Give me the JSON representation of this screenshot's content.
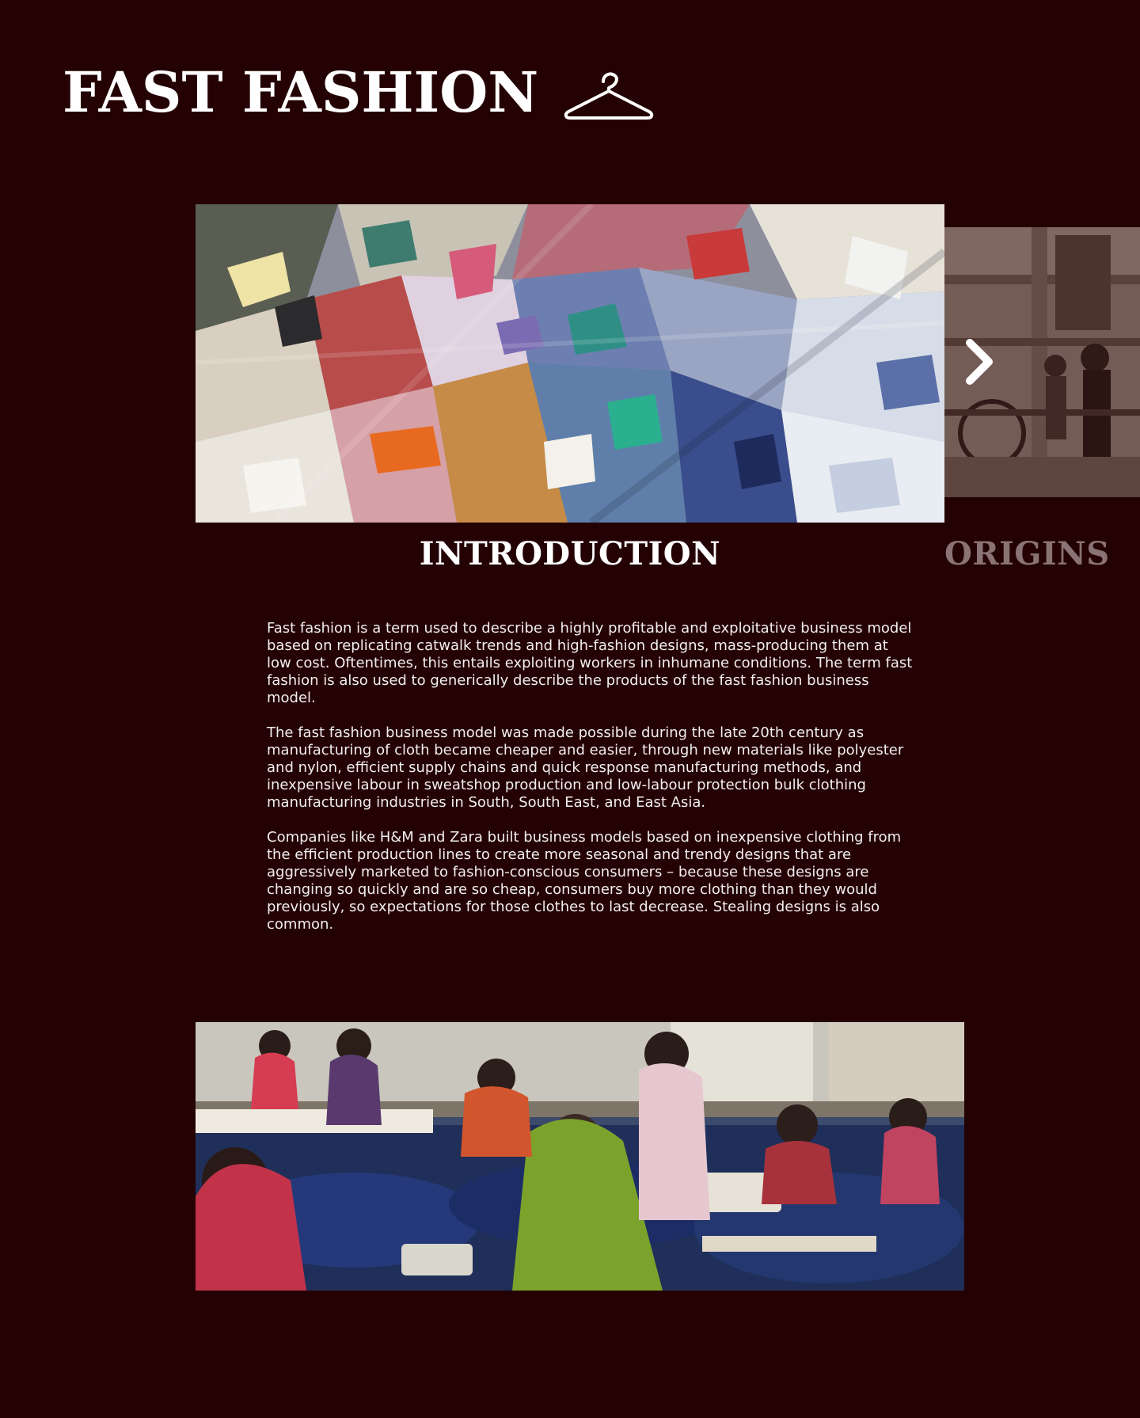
{
  "header": {
    "title": "FAST FASHION",
    "icon": "hanger-icon"
  },
  "carousel": {
    "current": {
      "caption": "INTRODUCTION",
      "image_subject": "pile of discarded textiles"
    },
    "next": {
      "caption": "ORIGINS",
      "image_subject": "historical sepia factory scene"
    },
    "next_icon": "chevron-right-icon"
  },
  "article": {
    "paragraphs": [
      "Fast fashion is a term used to describe a highly profitable and exploitative business model based on replicating catwalk trends and high-fashion designs, mass-producing them at low cost. Oftentimes, this entails exploiting workers in inhumane conditions. The term fast fashion is also used to generically describe the products of the fast fashion business model.",
      "The fast fashion business model was made possible during the late 20th century as manufacturing of cloth became cheaper and easier, through new materials like polyester and nylon, efficient supply chains and quick response manufacturing methods, and inexpensive labour in sweatshop production and low-labour protection bulk clothing manufacturing industries in South, South East, and East Asia.",
      "Companies like H&M and Zara built business models based on inexpensive clothing from the efficient production lines to create more seasonal and trendy designs that are aggressively marketed to fashion-conscious consumers – because these designs are changing so quickly and are so cheap, consumers buy more clothing than they would previously, so expectations for those clothes to last decrease. Stealing designs is also common."
    ]
  },
  "colors": {
    "background": "#240204",
    "text": "#ffffff",
    "muted_caption": "#8a7373"
  }
}
